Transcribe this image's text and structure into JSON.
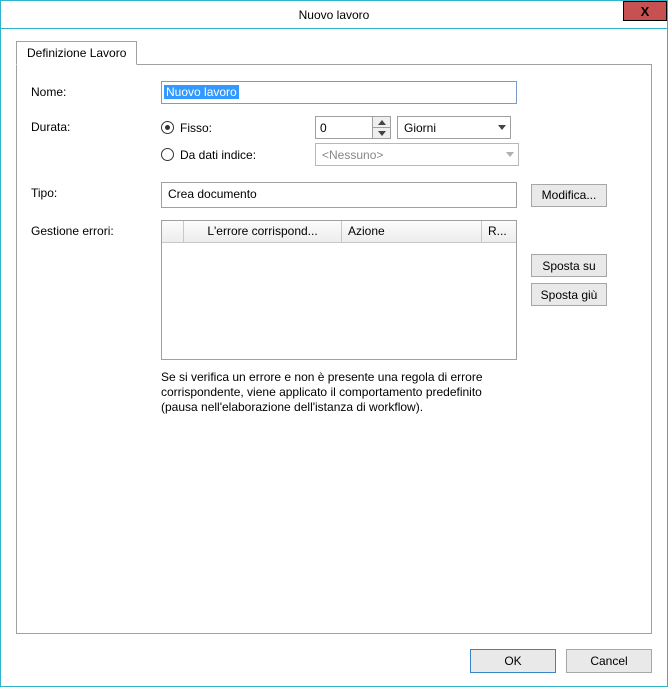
{
  "window": {
    "title": "Nuovo lavoro",
    "close_glyph": "X"
  },
  "tab": {
    "label": "Definizione Lavoro"
  },
  "form": {
    "name_label": "Nome:",
    "name_value": "Nuovo lavoro",
    "duration_label": "Durata:",
    "duration_fixed_label": "Fisso:",
    "duration_fixed_value": "0",
    "duration_unit_selected": "Giorni",
    "duration_index_label": "Da dati indice:",
    "duration_index_selected": "<Nessuno>",
    "type_label": "Tipo:",
    "type_value": "Crea documento",
    "modify_label": "Modifica...",
    "errors_label": "Gestione errori:",
    "grid": {
      "col_blank": "",
      "col_match": "L'errore corrispond...",
      "col_action": "Azione",
      "col_r": "R..."
    },
    "move_up_label": "Sposta su",
    "move_down_label": "Sposta giù",
    "help_text": "Se si verifica un errore e non è presente una regola di errore corrispondente, viene applicato il comportamento predefinito (pausa nell'elaborazione dell'istanza di workflow)."
  },
  "footer": {
    "ok": "OK",
    "cancel": "Cancel"
  }
}
